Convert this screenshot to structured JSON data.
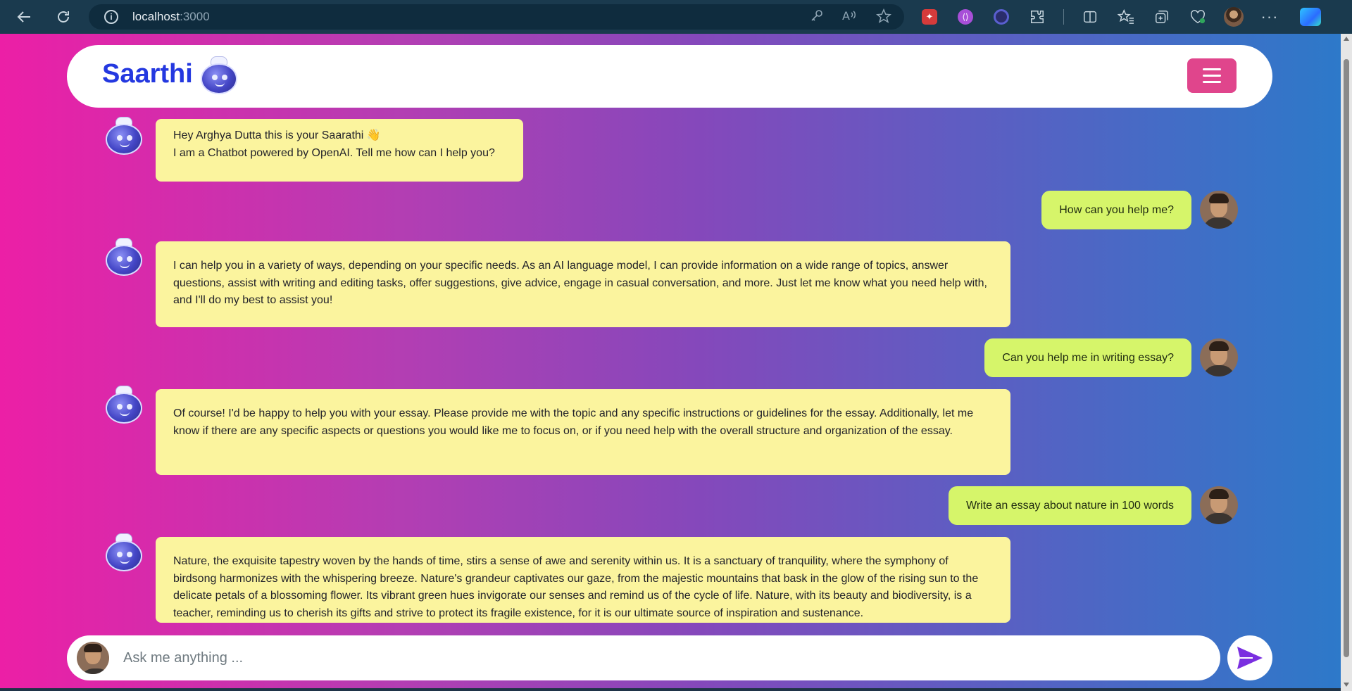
{
  "browser": {
    "url_host": "localhost",
    "url_port": ":3000",
    "icons": [
      "back-arrow-icon",
      "reload-icon",
      "info-icon",
      "key-icon",
      "read-aloud-icon",
      "favorite-star-icon",
      "extension-icon",
      "split-screen-icon",
      "favorites-icon",
      "collections-icon",
      "browser-essentials-icon",
      "profile-avatar-icon",
      "more-icon",
      "copilot-icon"
    ]
  },
  "header": {
    "brand": "Saarthi",
    "logo_icon": "robot-icon",
    "menu_icon": "hamburger-menu-icon"
  },
  "messages": [
    {
      "role": "bot",
      "lines": [
        "Hey Arghya Dutta this is your Saarathi 👋",
        "I am a Chatbot powered by OpenAI. Tell me how can I help you?"
      ]
    },
    {
      "role": "user",
      "text": "How can you help me?"
    },
    {
      "role": "bot",
      "lines": [
        "I can help you in a variety of ways, depending on your specific needs. As an AI language model, I can provide information on a wide range of topics, answer questions, assist with writing and editing tasks, offer suggestions, give advice, engage in casual conversation, and more. Just let me know what you need help with, and I'll do my best to assist you!"
      ]
    },
    {
      "role": "user",
      "text": "Can you help me in writing essay?"
    },
    {
      "role": "bot",
      "lines": [
        "Of course! I'd be happy to help you with your essay. Please provide me with the topic and any specific instructions or guidelines for the essay. Additionally, let me know if there are any specific aspects or questions you would like me to focus on, or if you need help with the overall structure and organization of the essay."
      ]
    },
    {
      "role": "user",
      "text": "Write an essay about nature in 100 words"
    },
    {
      "role": "bot",
      "lines": [
        "Nature, the exquisite tapestry woven by the hands of time, stirs a sense of awe and serenity within us. It is a sanctuary of tranquility, where the symphony of birdsong harmonizes with the whispering breeze. Nature's grandeur captivates our gaze, from the majestic mountains that bask in the glow of the rising sun to the delicate petals of a blossoming flower. Its vibrant green hues invigorate our senses and remind us of the cycle of life. Nature, with its beauty and biodiversity, is a teacher, reminding us to cherish its gifts and strive to protect its fragile existence, for it is our ultimate source of inspiration and sustenance."
      ]
    }
  ],
  "input": {
    "placeholder": "Ask me anything ...",
    "value": "",
    "send_icon": "send-icon"
  },
  "colors": {
    "bot_bubble": "#fbf49e",
    "user_bubble": "#d6f56a",
    "brand": "#2438e0",
    "menu_button": "#e0458c",
    "send_icon": "#7a2fe0"
  }
}
